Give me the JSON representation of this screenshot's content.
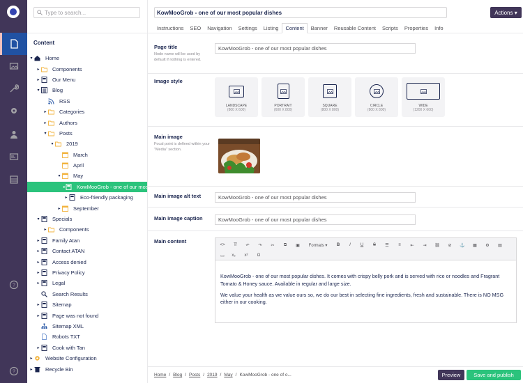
{
  "search": {
    "placeholder": "Type to search..."
  },
  "tree": {
    "header": "Content",
    "nodes": [
      {
        "label": "Home",
        "depth": 0,
        "caret": "▾",
        "icon": "home-icon"
      },
      {
        "label": "Components",
        "depth": 1,
        "caret": "▸",
        "icon": "folder-icon"
      },
      {
        "label": "Our Menu",
        "depth": 1,
        "caret": "▸",
        "icon": "document-icon"
      },
      {
        "label": "Blog",
        "depth": 1,
        "caret": "▾",
        "icon": "list-icon"
      },
      {
        "label": "RSS",
        "depth": 2,
        "caret": "",
        "icon": "rss-icon"
      },
      {
        "label": "Categories",
        "depth": 2,
        "caret": "▸",
        "icon": "folder-icon"
      },
      {
        "label": "Authors",
        "depth": 2,
        "caret": "▸",
        "icon": "folder-icon"
      },
      {
        "label": "Posts",
        "depth": 2,
        "caret": "▾",
        "icon": "folder-icon"
      },
      {
        "label": "2019",
        "depth": 3,
        "caret": "▾",
        "icon": "folder-icon"
      },
      {
        "label": "March",
        "depth": 4,
        "caret": "",
        "icon": "calendar-icon"
      },
      {
        "label": "April",
        "depth": 4,
        "caret": "",
        "icon": "calendar-icon"
      },
      {
        "label": "May",
        "depth": 4,
        "caret": "▾",
        "icon": "calendar-icon"
      },
      {
        "label": "KowMooGrob - one of our most popular dishes",
        "depth": 5,
        "caret": "▸",
        "icon": "document-icon",
        "selected": true
      },
      {
        "label": "Eco-friendly packaging",
        "depth": 5,
        "caret": "▸",
        "icon": "document-icon"
      },
      {
        "label": "September",
        "depth": 4,
        "caret": "▸",
        "icon": "calendar-icon"
      },
      {
        "label": "Specials",
        "depth": 1,
        "caret": "▾",
        "icon": "document-icon"
      },
      {
        "label": "Components",
        "depth": 2,
        "caret": "▸",
        "icon": "folder-icon"
      },
      {
        "label": "Family Atan",
        "depth": 1,
        "caret": "▸",
        "icon": "document-icon"
      },
      {
        "label": "Contact ATAN",
        "depth": 1,
        "caret": "▸",
        "icon": "document-icon"
      },
      {
        "label": "Access denied",
        "depth": 1,
        "caret": "▸",
        "icon": "document-icon"
      },
      {
        "label": "Privacy Policy",
        "depth": 1,
        "caret": "▸",
        "icon": "document-icon"
      },
      {
        "label": "Legal",
        "depth": 1,
        "caret": "▸",
        "icon": "document-icon"
      },
      {
        "label": "Search Results",
        "depth": 1,
        "caret": "",
        "icon": "search-icon"
      },
      {
        "label": "Sitemap",
        "depth": 1,
        "caret": "▸",
        "icon": "document-icon"
      },
      {
        "label": "Page was not found",
        "depth": 1,
        "caret": "▸",
        "icon": "document-icon"
      },
      {
        "label": "Sitemap XML",
        "depth": 1,
        "caret": "",
        "icon": "sitemap-icon"
      },
      {
        "label": "Robots TXT",
        "depth": 1,
        "caret": "",
        "icon": "file-icon"
      },
      {
        "label": "Cook with Tan",
        "depth": 1,
        "caret": "▸",
        "icon": "document-icon"
      },
      {
        "label": "Website Configuration",
        "depth": 0,
        "caret": "▸",
        "icon": "gear-icon"
      },
      {
        "label": "Recycle Bin",
        "depth": 0,
        "caret": "▸",
        "icon": "trash-icon"
      }
    ]
  },
  "header": {
    "page_name": "KowMooGrob - one of our most popular dishes",
    "actions_label": "Actions ▾",
    "tabs": [
      "Instructions",
      "SEO",
      "Navigation",
      "Settings",
      "Listing",
      "Content",
      "Banner",
      "Reusable Content",
      "Scripts",
      "Properties",
      "Info"
    ],
    "active_tab": "Content"
  },
  "fields": {
    "page_title": {
      "label": "Page title",
      "description": "Node name will be used by default if nothing is entered.",
      "value": "KowMooGrob - one of our most popular dishes"
    },
    "image_style": {
      "label": "Image style",
      "options": [
        {
          "name": "LANDSCAPE",
          "size": "(800 X 600)"
        },
        {
          "name": "PORTRAIT",
          "size": "(600 X 800)"
        },
        {
          "name": "SQUARE",
          "size": "(800 X 800)"
        },
        {
          "name": "CIRCLE",
          "size": "(800 X 800)"
        },
        {
          "name": "WIDE",
          "size": "(1200 X 600)",
          "selected": true
        }
      ]
    },
    "main_image": {
      "label": "Main image",
      "description": "Focal point is defined within your \"Media\" section."
    },
    "alt_text": {
      "label": "Main image alt text",
      "value": "KowMooGrob - one of our most popular dishes"
    },
    "caption": {
      "label": "Main image caption",
      "value": "KowMooGrob - one of our most popular dishes"
    },
    "main_content": {
      "label": "Main content",
      "formats_label": "Formats ▾",
      "paragraphs": [
        "KowMooGrob - one of our most popular dishes.  It comes with crispy belly pork and is served with rice or noodles and Fragrant Tomato & Honey sauce.  Available in regular and large size.",
        "We value your health as we value ours so, we do our best in selecting fine ingredients, fresh and sustainable. There is NO MSG either in our cooking."
      ]
    }
  },
  "footer": {
    "breadcrumbs": [
      "Home",
      "Blog",
      "Posts",
      "2019",
      "May",
      "KowMooGrob - one of o..."
    ],
    "preview_label": "Preview",
    "publish_label": "Save and publish"
  },
  "colors": {
    "rail": "#413659",
    "accent": "#2bc37c",
    "active_rail": "#2152a3"
  }
}
